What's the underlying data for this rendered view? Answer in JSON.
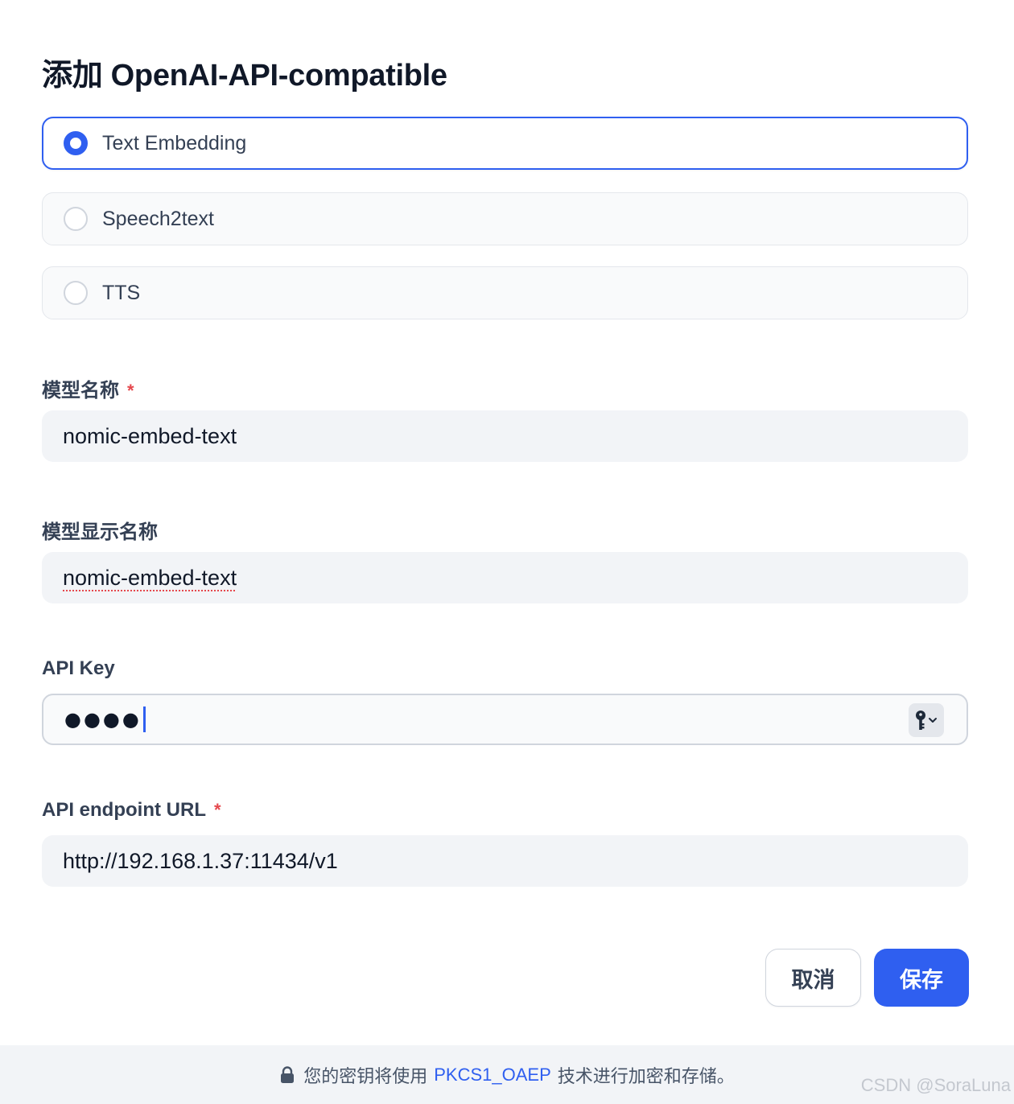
{
  "dialog": {
    "title": "添加 OpenAI-API-compatible"
  },
  "model_types": [
    {
      "label": "Text Embedding",
      "selected": true
    },
    {
      "label": "Speech2text",
      "selected": false
    },
    {
      "label": "TTS",
      "selected": false
    }
  ],
  "fields": {
    "model_name": {
      "label": "模型名称",
      "required_mark": "*",
      "value": "nomic-embed-text"
    },
    "display_name": {
      "label": "模型显示名称",
      "value": "nomic-embed-text"
    },
    "api_key": {
      "label": "API Key",
      "masked_value": "●●●●",
      "icon": "key-icon"
    },
    "endpoint_url": {
      "label": "API endpoint URL",
      "required_mark": "*",
      "value": "http://192.168.1.37:11434/v1"
    }
  },
  "buttons": {
    "cancel": "取消",
    "save": "保存"
  },
  "footer": {
    "icon": "lock-icon",
    "text_before": "您的密钥将使用",
    "link": "PKCS1_OAEP",
    "text_after": "技术进行加密和存储。"
  },
  "watermark": "CSDN @SoraLuna",
  "colors": {
    "accent": "#2f5ff0",
    "required": "#e5484d",
    "input_bg": "#f2f4f7"
  }
}
